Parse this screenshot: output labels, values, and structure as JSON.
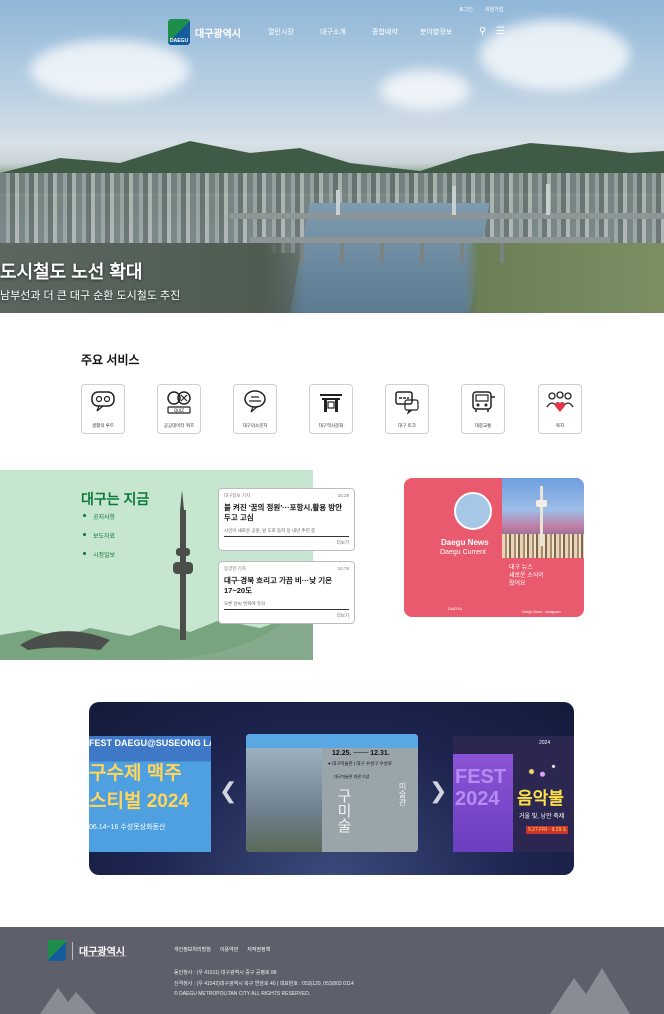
{
  "header": {
    "logo_text": "대구광역시",
    "logo_badge": "DAEGU",
    "menu": [
      "열린시장",
      "대구소개",
      "종합예약",
      "분야별정보"
    ],
    "utility": [
      "로그인",
      "회원가입"
    ]
  },
  "hero": {
    "title": "도시철도 노선 확대",
    "subtitle": "남부선과 더 큰 대구 순환 도시철도 추진"
  },
  "services": {
    "title": "주요 서비스",
    "items": [
      {
        "label": "생활의 루트",
        "icon": "chat-face-icon"
      },
      {
        "label": "공공데이터 퀴즈",
        "icon": "quiz-icon"
      },
      {
        "label": "대구의소문자",
        "icon": "speech-bubble-icon"
      },
      {
        "label": "대구역사문화",
        "icon": "gate-icon"
      },
      {
        "label": "대구 토크",
        "icon": "talk-icon"
      },
      {
        "label": "대중교통",
        "icon": "bus-icon"
      },
      {
        "label": "복지",
        "icon": "people-heart-icon"
      }
    ]
  },
  "now": {
    "title": "대구는 지금",
    "links": [
      "공지사항",
      "보도자료",
      "시정일보"
    ],
    "cards": [
      {
        "source": "대구일보 기자",
        "date": "10.28",
        "title": "불 켜진 '꿈의 정원'···포항시,활용 방안 두고 고심",
        "desc": "시민이 새로운 공원, 앞 도로 등지 등 내년 추진 중",
        "more": "더보기"
      },
      {
        "source": "동양한 기자",
        "date": "10.76",
        "title": "대구·경북 흐리고 가끔 비···낮 기온 17~20도",
        "desc": "오른 날씨 변화에 유의",
        "more": "더보기"
      }
    ]
  },
  "news": {
    "title": "Daegu News",
    "subtitle": "Daegu Current",
    "desc": [
      "대구 뉴스",
      "새로운 소식이",
      "왔어요"
    ],
    "foot_left": "DAEGU",
    "foot_right": "Daegu News · instagram"
  },
  "banner": {
    "slide1": {
      "line1": "FEST DAEGU@SUSEONG LAKE",
      "line2": "구수제 맥주",
      "line3": "스티벌 2024",
      "line4": "06.14~16 수성못상화동산"
    },
    "slide2": {
      "date": "12.25. ─── 12.31.",
      "place": "● 대구미술관 | 대구 수성구 수성로",
      "label": "대구미술관 개관 기념",
      "big": "구미술",
      "big2": "미술관"
    },
    "slide3": {
      "year": "2024",
      "title": "음악불",
      "sub": "거울 빛, 낭만 축제",
      "date": "9.27.FRI - 9.29.S",
      "side": "FEST 2024"
    }
  },
  "footer": {
    "logo_name": "대구광역시",
    "logo_eng": "DAEGU METROPOLITAN CITY",
    "links": [
      "개인정보처리방침",
      "이용약관",
      "저작권정책"
    ],
    "address1": "동인청사 : (우 41911) 대구광역시 중구 공평로 88",
    "address2": "산격청사 : (우 41542)대구광역시 북구 연암로 40 | 대표번호 : 053)120, 053)803 0114",
    "copyright": "© DAEGU METROPOLITAN CITY ALL RIGHTS RESERVED."
  }
}
